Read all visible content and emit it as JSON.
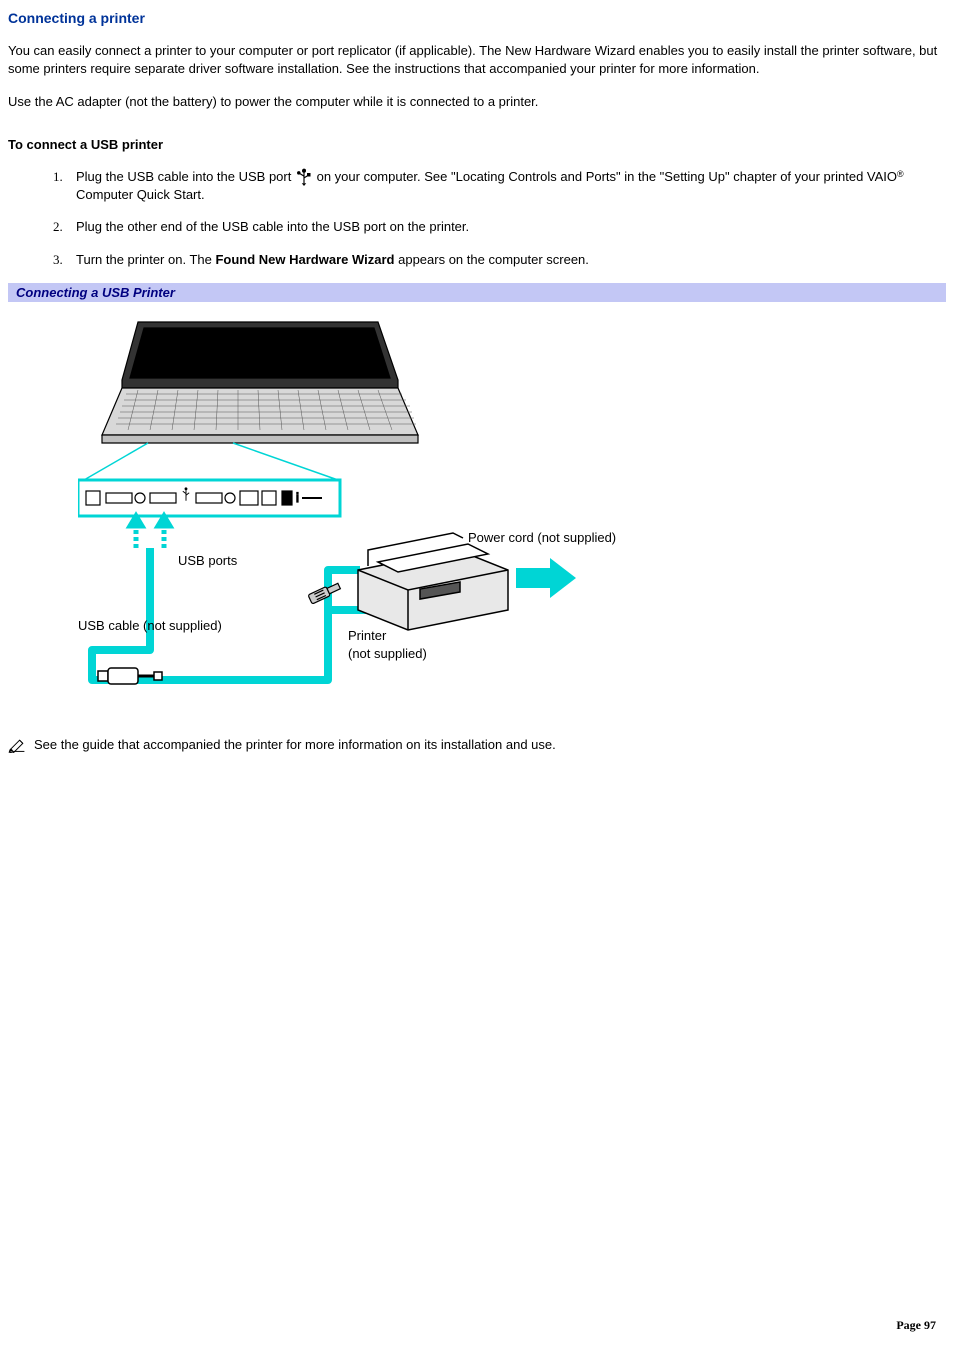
{
  "heading": "Connecting a printer",
  "intro1": "You can easily connect a printer to your computer or port replicator (if applicable). The New Hardware Wizard enables you to easily install the printer software, but some printers require separate driver software installation. See the instructions that accompanied your printer for more information.",
  "intro2": "Use the AC adapter (not the battery) to power the computer while it is connected to a printer.",
  "subheading": "To connect a USB printer",
  "steps": {
    "s1a": "Plug the USB cable into the USB port ",
    "s1b": " on your computer. See \"Locating Controls and Ports\" in the \"Setting Up\" chapter of your printed VAIO",
    "s1c": " Computer Quick Start.",
    "s2": "Plug the other end of the USB cable into the USB port on the printer.",
    "s3a": "Turn the printer on. The ",
    "s3bold": "Found New Hardware Wizard",
    "s3b": " appears on the computer screen."
  },
  "figure_title": "Connecting a USB Printer",
  "labels": {
    "usb_ports": "USB ports",
    "usb_cable": "USB cable (not supplied)",
    "power_cord": "Power cord (not supplied)",
    "printer_l1": "Printer",
    "printer_l2": "(not supplied)"
  },
  "note": "See the guide that accompanied the printer for more information on its installation and use.",
  "page_label": "Page 97",
  "reg_mark": "®"
}
